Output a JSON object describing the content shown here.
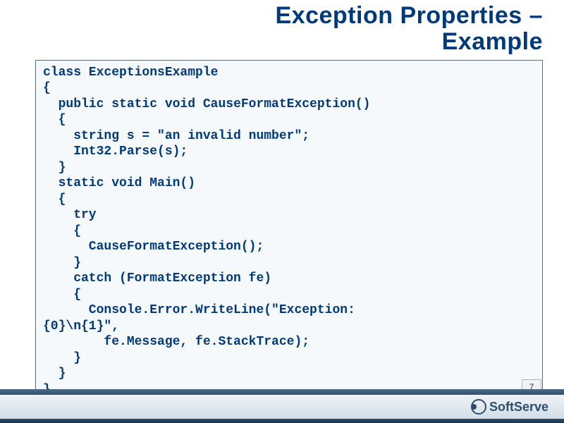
{
  "title_line1": "Exception Properties –",
  "title_line2": "Example",
  "code": "class ExceptionsExample\n{\n  public static void CauseFormatException()\n  {\n    string s = \"an invalid number\";\n    Int32.Parse(s);\n  }\n  static void Main()\n  {\n    try\n    {\n      CauseFormatException();\n    }\n    catch (FormatException fe)\n    {\n      Console.Error.WriteLine(\"Exception:\n{0}\\n{1}\",\n        fe.Message, fe.StackTrace);\n    }\n  }\n}",
  "brand": "SoftServe",
  "page_number": "7"
}
